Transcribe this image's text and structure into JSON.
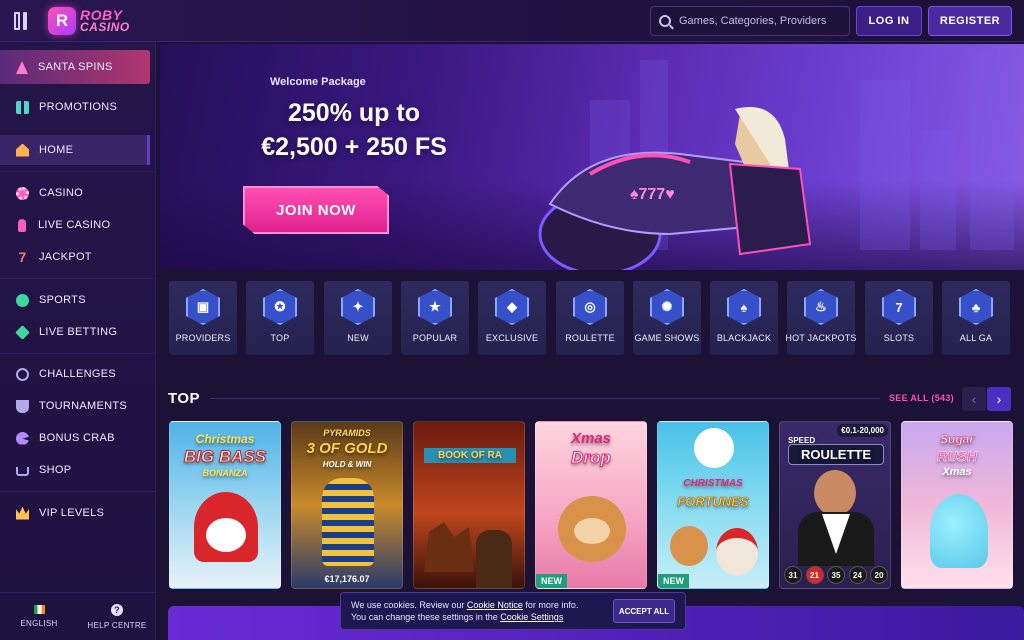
{
  "brand": {
    "line1": "ROBY",
    "line2": "CASINO",
    "badge": "R"
  },
  "header": {
    "search_placeholder": "Games, Categories, Providers",
    "login_label": "LOG IN",
    "register_label": "REGISTER"
  },
  "sidebar": {
    "items": [
      {
        "label": "SANTA SPINS",
        "icon": "tree-icon"
      },
      {
        "label": "PROMOTIONS",
        "icon": "gift-icon"
      },
      {
        "label": "HOME",
        "icon": "home-icon"
      },
      {
        "label": "CASINO",
        "icon": "chip-icon"
      },
      {
        "label": "LIVE CASINO",
        "icon": "microphone-icon"
      },
      {
        "label": "JACKPOT",
        "icon": "seven-icon"
      },
      {
        "label": "SPORTS",
        "icon": "ball-icon"
      },
      {
        "label": "LIVE BETTING",
        "icon": "bet-icon"
      },
      {
        "label": "CHALLENGES",
        "icon": "medal-icon"
      },
      {
        "label": "TOURNAMENTS",
        "icon": "trophy-icon"
      },
      {
        "label": "BONUS CRAB",
        "icon": "crab-icon"
      },
      {
        "label": "SHOP",
        "icon": "cart-icon"
      },
      {
        "label": "VIP LEVELS",
        "icon": "crown-icon"
      }
    ],
    "footer": {
      "language": "ENGLISH",
      "help": "HELP CENTRE",
      "help_glyph": "?"
    }
  },
  "hero": {
    "subtitle": "Welcome Package",
    "title_line1": "250% up to",
    "title_line2": "€2,500 + 250 FS",
    "cta": "JOIN NOW",
    "plate": "♠777♥"
  },
  "categories": [
    {
      "label": "PROVIDERS",
      "glyph": "▣"
    },
    {
      "label": "TOP",
      "glyph": "✪"
    },
    {
      "label": "NEW",
      "glyph": "✦"
    },
    {
      "label": "POPULAR",
      "glyph": "★"
    },
    {
      "label": "EXCLUSIVE",
      "glyph": "◆"
    },
    {
      "label": "ROULETTE",
      "glyph": "◎"
    },
    {
      "label": "GAME SHOWS",
      "glyph": "✺"
    },
    {
      "label": "BLACKJACK",
      "glyph": "♠"
    },
    {
      "label": "HOT JACKPOTS",
      "glyph": "♨"
    },
    {
      "label": "SLOTS",
      "glyph": "7"
    },
    {
      "label": "ALL GA",
      "glyph": "♣"
    }
  ],
  "top_section": {
    "title": "TOP",
    "see_all": "SEE ALL (543)",
    "prev": "‹",
    "next": "›",
    "games": [
      {
        "title_top": "Christmas",
        "title_main": "BIG BASS",
        "title_sub": "BONANZA",
        "badge": "",
        "jackpot": ""
      },
      {
        "title_top": "PYRAMIDS",
        "title_main": "3 OF GOLD",
        "title_sub": "HOLD & WIN",
        "badge": "",
        "jackpot": "€17,176.07"
      },
      {
        "title_top": "",
        "title_main": "BOOK OF RA",
        "title_sub": "",
        "badge": "",
        "jackpot": ""
      },
      {
        "title_top": "Xmas",
        "title_main": "Drop",
        "title_sub": "",
        "badge": "NEW",
        "jackpot": ""
      },
      {
        "title_top": "CHRISTMAS",
        "title_main": "FORTUNES",
        "title_sub": "",
        "badge": "NEW",
        "jackpot": ""
      },
      {
        "title_top": "SPEED",
        "title_main": "ROULETTE",
        "title_sub": "",
        "badge": "",
        "jackpot": "",
        "limits": "€0.1-20,000",
        "numbers": [
          "31",
          "21",
          "35",
          "24",
          "20"
        ]
      },
      {
        "title_top": "Sugar",
        "title_main": "RUSH",
        "title_sub": "Xmas",
        "badge": "",
        "jackpot": ""
      }
    ]
  },
  "cookie": {
    "text_before": "We use cookies. Review our ",
    "link1": "Cookie Notice",
    "text_middle": " for more info.",
    "text_line2": "You can change these settings in the ",
    "link2": "Cookie Settings",
    "accept": "ACCEPT ALL"
  },
  "colors": {
    "accent_pink": "#ff4fb8",
    "accent_purple": "#4b2fc2",
    "background": "#1b1236",
    "new_badge": "#1e9e7a"
  }
}
